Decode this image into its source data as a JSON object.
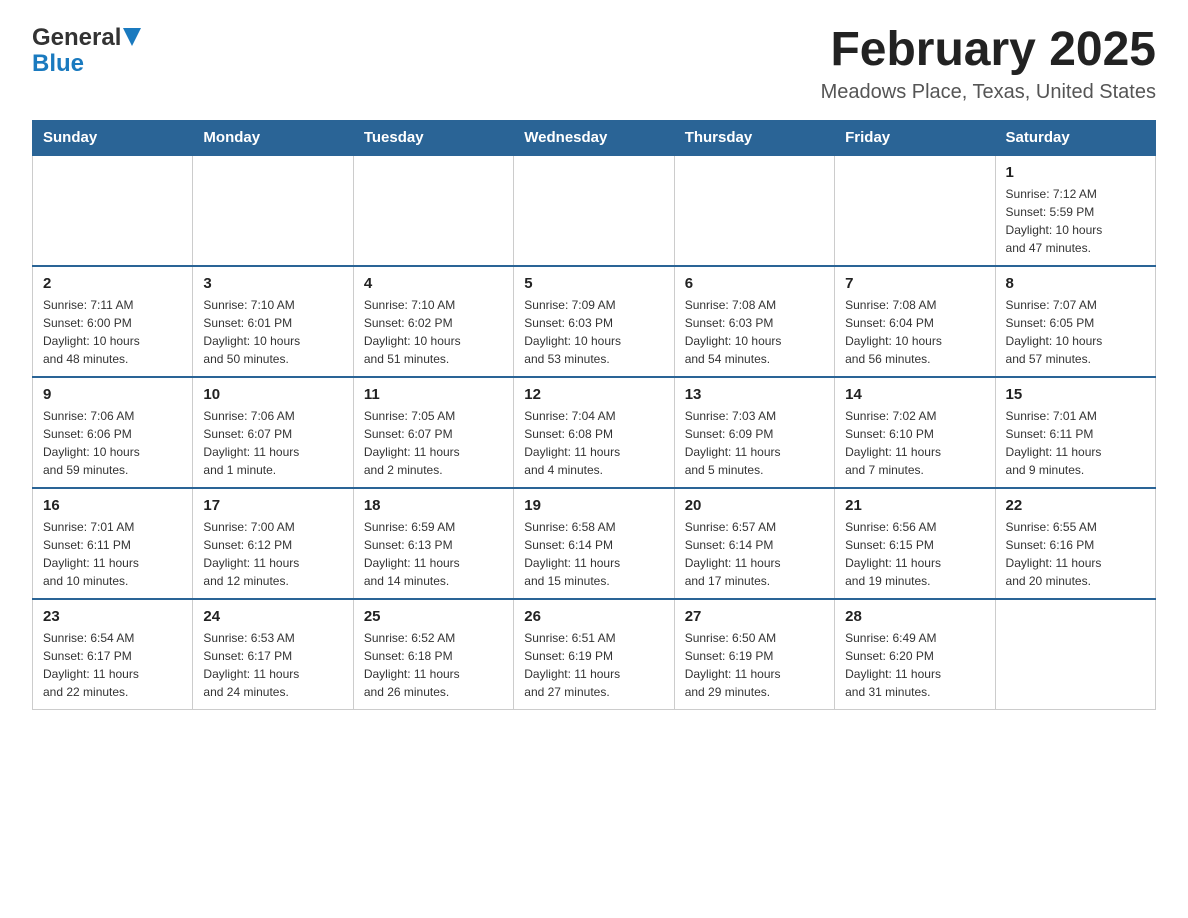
{
  "logo": {
    "general": "General",
    "blue": "Blue",
    "triangle": "▲"
  },
  "header": {
    "title": "February 2025",
    "location": "Meadows Place, Texas, United States"
  },
  "weekdays": [
    "Sunday",
    "Monday",
    "Tuesday",
    "Wednesday",
    "Thursday",
    "Friday",
    "Saturday"
  ],
  "weeks": [
    {
      "days": [
        {
          "num": "",
          "info": ""
        },
        {
          "num": "",
          "info": ""
        },
        {
          "num": "",
          "info": ""
        },
        {
          "num": "",
          "info": ""
        },
        {
          "num": "",
          "info": ""
        },
        {
          "num": "",
          "info": ""
        },
        {
          "num": "1",
          "info": "Sunrise: 7:12 AM\nSunset: 5:59 PM\nDaylight: 10 hours\nand 47 minutes."
        }
      ]
    },
    {
      "days": [
        {
          "num": "2",
          "info": "Sunrise: 7:11 AM\nSunset: 6:00 PM\nDaylight: 10 hours\nand 48 minutes."
        },
        {
          "num": "3",
          "info": "Sunrise: 7:10 AM\nSunset: 6:01 PM\nDaylight: 10 hours\nand 50 minutes."
        },
        {
          "num": "4",
          "info": "Sunrise: 7:10 AM\nSunset: 6:02 PM\nDaylight: 10 hours\nand 51 minutes."
        },
        {
          "num": "5",
          "info": "Sunrise: 7:09 AM\nSunset: 6:03 PM\nDaylight: 10 hours\nand 53 minutes."
        },
        {
          "num": "6",
          "info": "Sunrise: 7:08 AM\nSunset: 6:03 PM\nDaylight: 10 hours\nand 54 minutes."
        },
        {
          "num": "7",
          "info": "Sunrise: 7:08 AM\nSunset: 6:04 PM\nDaylight: 10 hours\nand 56 minutes."
        },
        {
          "num": "8",
          "info": "Sunrise: 7:07 AM\nSunset: 6:05 PM\nDaylight: 10 hours\nand 57 minutes."
        }
      ]
    },
    {
      "days": [
        {
          "num": "9",
          "info": "Sunrise: 7:06 AM\nSunset: 6:06 PM\nDaylight: 10 hours\nand 59 minutes."
        },
        {
          "num": "10",
          "info": "Sunrise: 7:06 AM\nSunset: 6:07 PM\nDaylight: 11 hours\nand 1 minute."
        },
        {
          "num": "11",
          "info": "Sunrise: 7:05 AM\nSunset: 6:07 PM\nDaylight: 11 hours\nand 2 minutes."
        },
        {
          "num": "12",
          "info": "Sunrise: 7:04 AM\nSunset: 6:08 PM\nDaylight: 11 hours\nand 4 minutes."
        },
        {
          "num": "13",
          "info": "Sunrise: 7:03 AM\nSunset: 6:09 PM\nDaylight: 11 hours\nand 5 minutes."
        },
        {
          "num": "14",
          "info": "Sunrise: 7:02 AM\nSunset: 6:10 PM\nDaylight: 11 hours\nand 7 minutes."
        },
        {
          "num": "15",
          "info": "Sunrise: 7:01 AM\nSunset: 6:11 PM\nDaylight: 11 hours\nand 9 minutes."
        }
      ]
    },
    {
      "days": [
        {
          "num": "16",
          "info": "Sunrise: 7:01 AM\nSunset: 6:11 PM\nDaylight: 11 hours\nand 10 minutes."
        },
        {
          "num": "17",
          "info": "Sunrise: 7:00 AM\nSunset: 6:12 PM\nDaylight: 11 hours\nand 12 minutes."
        },
        {
          "num": "18",
          "info": "Sunrise: 6:59 AM\nSunset: 6:13 PM\nDaylight: 11 hours\nand 14 minutes."
        },
        {
          "num": "19",
          "info": "Sunrise: 6:58 AM\nSunset: 6:14 PM\nDaylight: 11 hours\nand 15 minutes."
        },
        {
          "num": "20",
          "info": "Sunrise: 6:57 AM\nSunset: 6:14 PM\nDaylight: 11 hours\nand 17 minutes."
        },
        {
          "num": "21",
          "info": "Sunrise: 6:56 AM\nSunset: 6:15 PM\nDaylight: 11 hours\nand 19 minutes."
        },
        {
          "num": "22",
          "info": "Sunrise: 6:55 AM\nSunset: 6:16 PM\nDaylight: 11 hours\nand 20 minutes."
        }
      ]
    },
    {
      "days": [
        {
          "num": "23",
          "info": "Sunrise: 6:54 AM\nSunset: 6:17 PM\nDaylight: 11 hours\nand 22 minutes."
        },
        {
          "num": "24",
          "info": "Sunrise: 6:53 AM\nSunset: 6:17 PM\nDaylight: 11 hours\nand 24 minutes."
        },
        {
          "num": "25",
          "info": "Sunrise: 6:52 AM\nSunset: 6:18 PM\nDaylight: 11 hours\nand 26 minutes."
        },
        {
          "num": "26",
          "info": "Sunrise: 6:51 AM\nSunset: 6:19 PM\nDaylight: 11 hours\nand 27 minutes."
        },
        {
          "num": "27",
          "info": "Sunrise: 6:50 AM\nSunset: 6:19 PM\nDaylight: 11 hours\nand 29 minutes."
        },
        {
          "num": "28",
          "info": "Sunrise: 6:49 AM\nSunset: 6:20 PM\nDaylight: 11 hours\nand 31 minutes."
        },
        {
          "num": "",
          "info": ""
        }
      ]
    }
  ]
}
